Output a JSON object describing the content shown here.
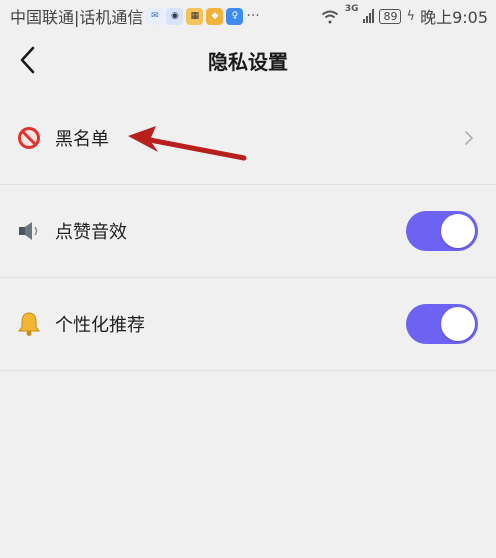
{
  "status_bar": {
    "carrier": "中国联通|话机通信",
    "network_type": "3G",
    "battery": "89",
    "time": "晚上9:05",
    "more": "···",
    "app_badges": [
      {
        "icon": "messenger-app-icon",
        "color": "#e7eefc"
      },
      {
        "icon": "qq-app-icon",
        "color": "#d9e4fb"
      },
      {
        "icon": "cat-app-icon",
        "color": "#f4c35a"
      },
      {
        "icon": "yellow-app-icon",
        "color": "#f2b33d"
      },
      {
        "icon": "bulb-app-icon",
        "color": "#3d8cf2"
      }
    ]
  },
  "header": {
    "title": "隐私设置"
  },
  "settings": [
    {
      "label": "黑名单",
      "icon": "blocked-icon",
      "control": "chevron"
    },
    {
      "label": "点赞音效",
      "icon": "speaker-icon",
      "control": "toggle",
      "on": true
    },
    {
      "label": "个性化推荐",
      "icon": "bell-icon",
      "control": "toggle",
      "on": true
    }
  ],
  "colors": {
    "background": "#f0f0f0",
    "toggle_on": "#6d63f2",
    "annotation_arrow": "#b8201e",
    "divider": "#e2e2e2"
  }
}
